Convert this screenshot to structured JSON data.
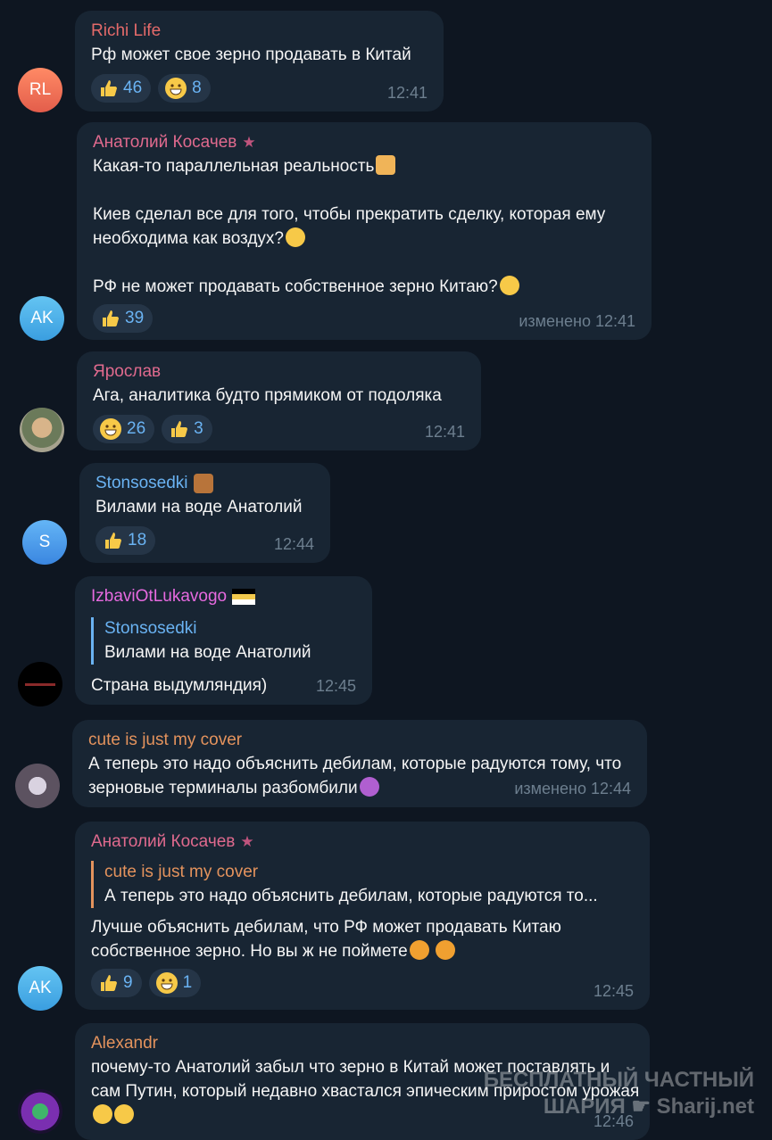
{
  "colors": {
    "background": "#0e1621",
    "bubble": "#182533",
    "reaction_bg": "#253547",
    "accent_blue": "#6ab3f3",
    "time_gray": "#6d7f8f",
    "name_red": "#e46a6a",
    "name_pink": "#e06a8e",
    "name_orange": "#e4935d",
    "name_blue": "#6ab3f3",
    "name_magenta": "#e66adf"
  },
  "messages": [
    {
      "author": "Richi Life",
      "avatar_initials": "RL",
      "text": "Рф может свое зерно продавать в Китай",
      "reactions": [
        {
          "icon": "thumbs-up-icon",
          "count": "46"
        },
        {
          "icon": "grinning-face-icon",
          "count": "8"
        }
      ],
      "time": "12:41"
    },
    {
      "author": "Анатолий Косачев",
      "avatar_initials": "AK",
      "text": "Какая-то параллельная реальность",
      "text_2": "Киев сделал все для того, чтобы прекратить сделку, которая ему необходима как воздух?",
      "text_3": "РФ не может продавать собственное зерно Китаю?",
      "reactions": [
        {
          "icon": "thumbs-up-icon",
          "count": "39"
        }
      ],
      "time": "изменено 12:41"
    },
    {
      "author": "Ярослав",
      "avatar_initials": "",
      "text": "Ага, аналитика будто прямиком от подоляка",
      "reactions": [
        {
          "icon": "grinning-face-icon",
          "count": "26"
        },
        {
          "icon": "thumbs-up-icon",
          "count": "3"
        }
      ],
      "time": "12:41"
    },
    {
      "author": "Stonsosedki",
      "avatar_initials": "S",
      "text": "Вилами на воде Анатолий",
      "reactions": [
        {
          "icon": "thumbs-up-icon",
          "count": "18"
        }
      ],
      "time": "12:44"
    },
    {
      "author": "IzbaviOtLukavogo",
      "avatar_initials": "",
      "reply_author": "Stonsosedki",
      "reply_text": "Вилами на воде Анатолий",
      "text": "Страна выдумляндия)",
      "time": "12:45"
    },
    {
      "author": "cute is just my cover",
      "avatar_initials": "",
      "text": "А теперь это надо объяснить дебилам, которые радуются тому, что зерновые терминалы разбомбили",
      "time": "изменено 12:44"
    },
    {
      "author": "Анатолий Косачев",
      "avatar_initials": "AK",
      "reply_author": "cute is just my cover",
      "reply_text": "А теперь это надо объяснить дебилам, которые радуются то...",
      "text": "Лучше объяснить дебилам, что РФ может продавать Китаю собственное зерно. Но вы ж не поймете",
      "reactions": [
        {
          "icon": "thumbs-up-icon",
          "count": "9"
        },
        {
          "icon": "grinning-face-icon",
          "count": "1"
        }
      ],
      "time": "12:45"
    },
    {
      "author": "Alexandr",
      "avatar_initials": "",
      "text": "почему-то Анатолий забыл что зерно в Китай может поставлять и сам Путин, который недавно хвастался эпическим приростом урожая",
      "time": "12:46"
    }
  ],
  "watermark": {
    "line1": "БЕСПЛАТНЫЙ ЧАСТНЫЙ",
    "line2": "ШАРИЯ",
    "site": "Sharij.net"
  }
}
